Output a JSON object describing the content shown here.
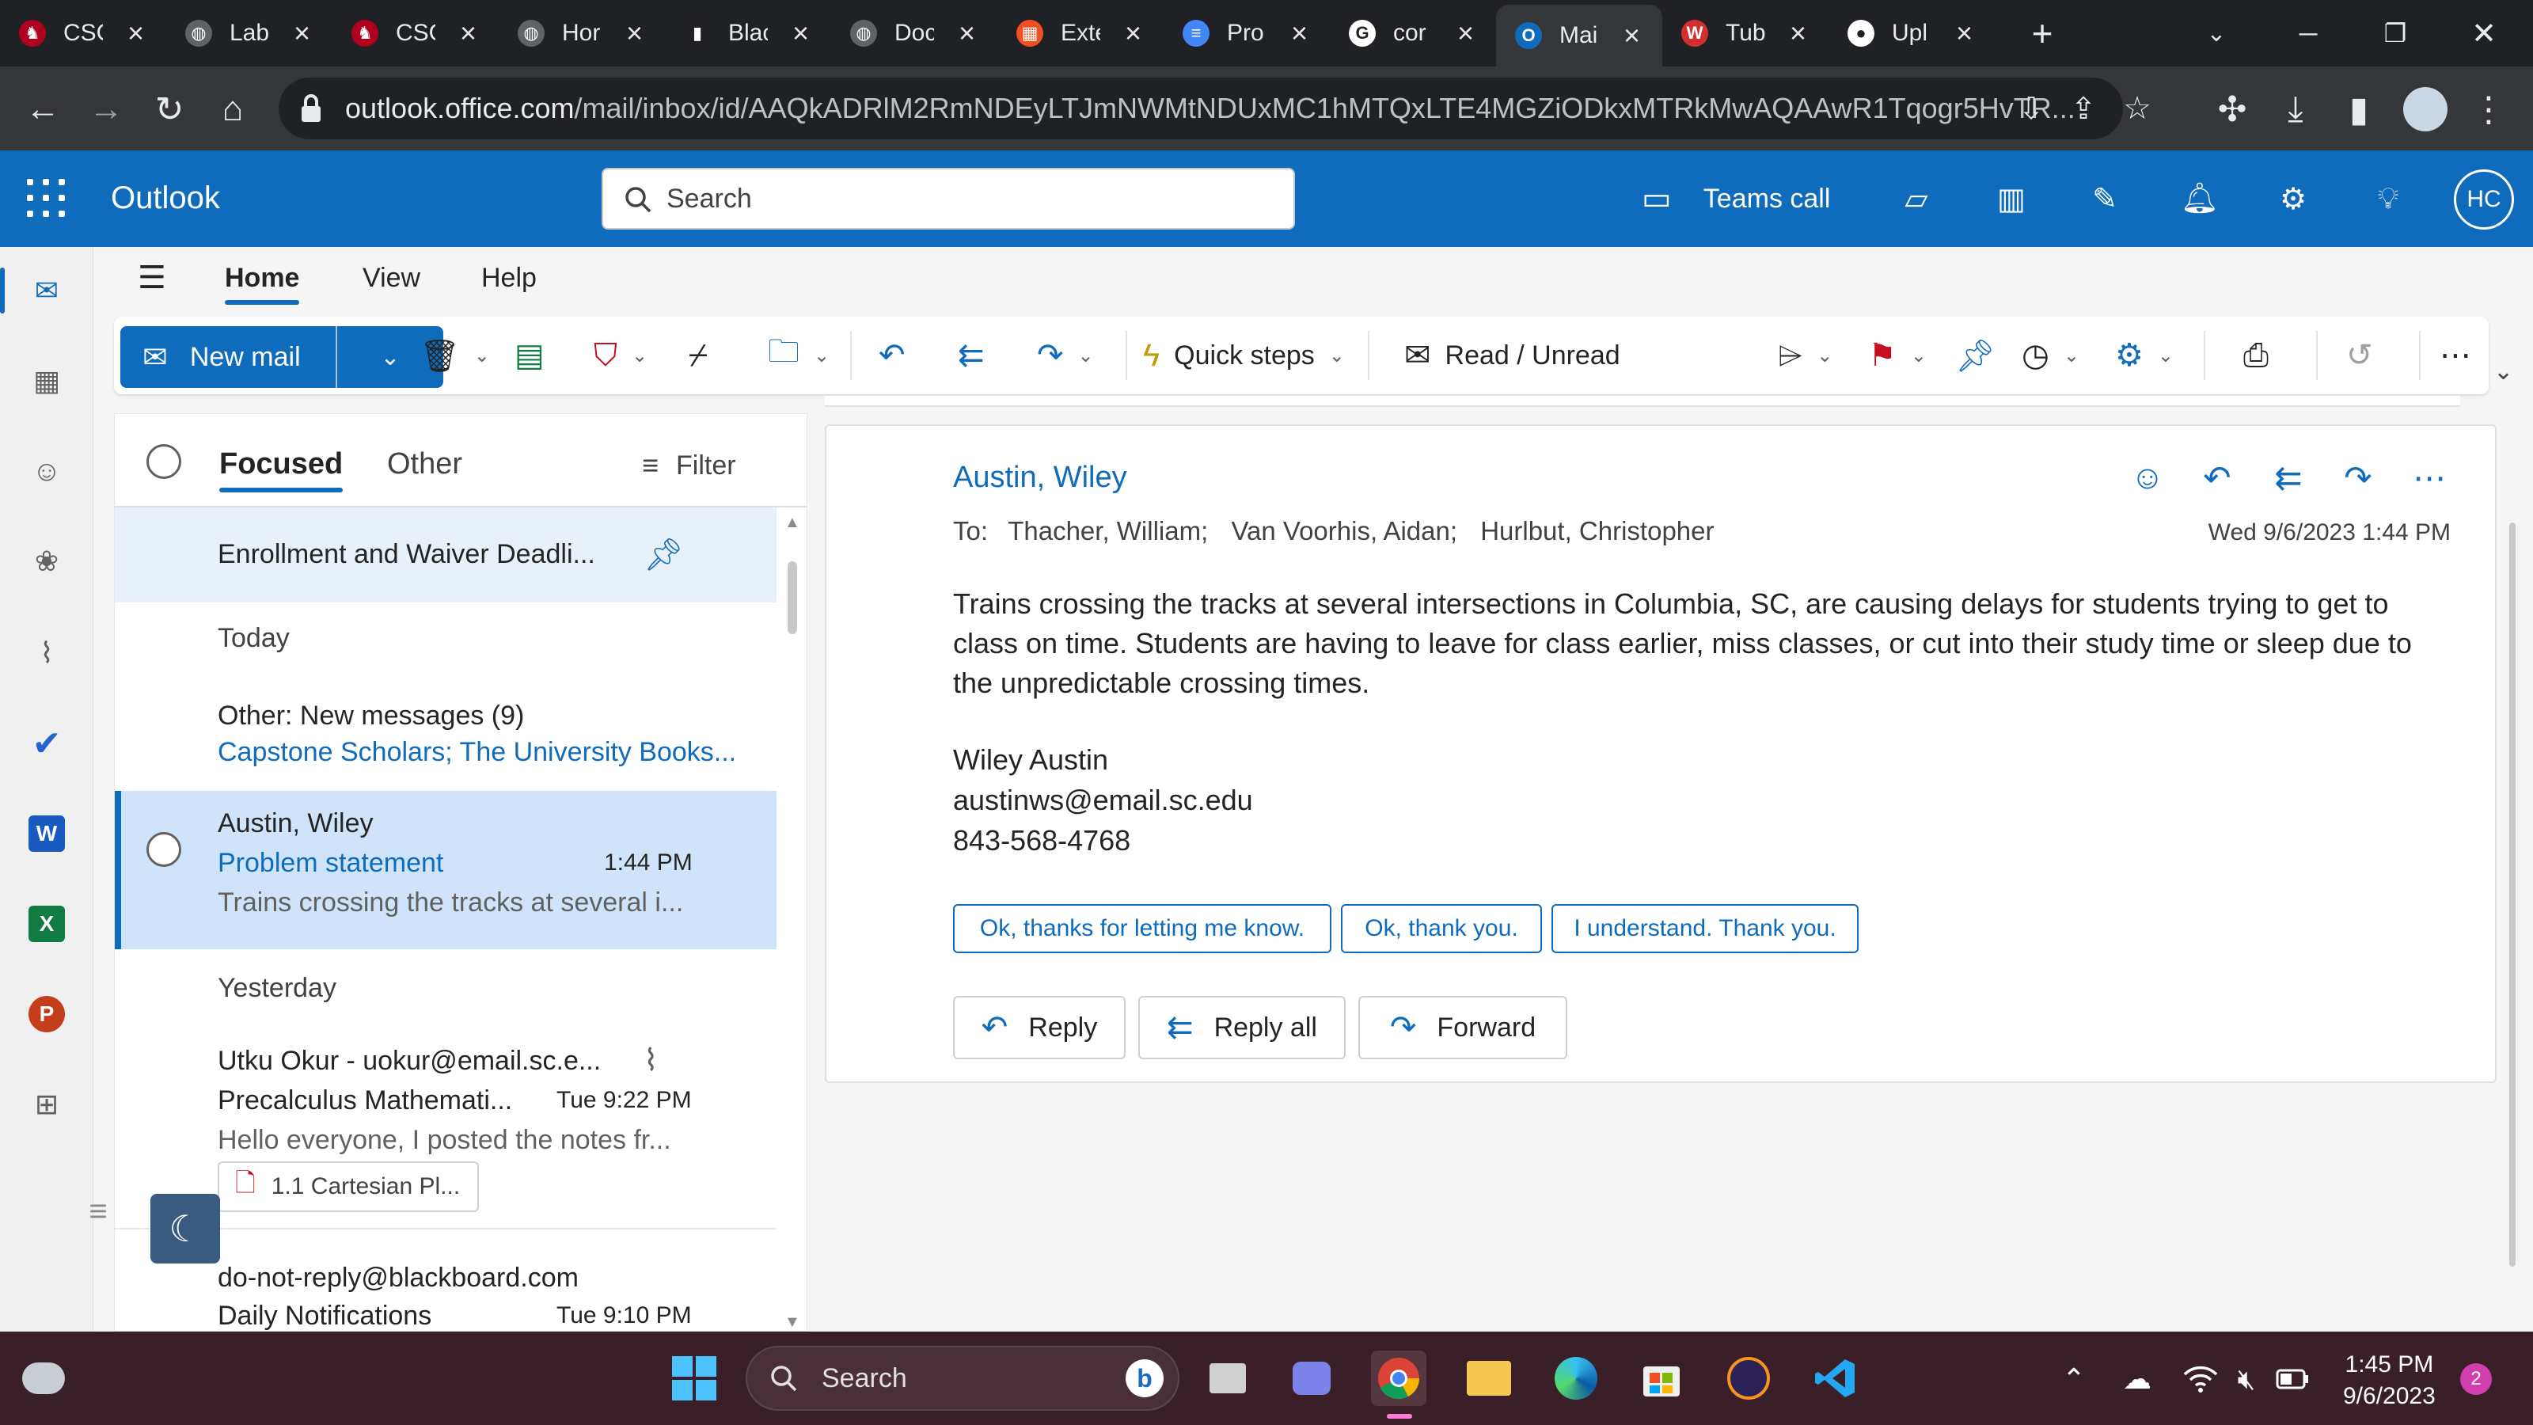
{
  "browser": {
    "tabs": [
      {
        "title": "CSC",
        "favicon": "spartan-icon",
        "color": "#b00020",
        "glyph": "♞"
      },
      {
        "title": "Lab",
        "favicon": "globe-icon",
        "color": "#5f6368",
        "glyph": "◍"
      },
      {
        "title": "CSC",
        "favicon": "spartan-icon",
        "color": "#b00020",
        "glyph": "♞"
      },
      {
        "title": "Hor",
        "favicon": "globe-icon",
        "color": "#5f6368",
        "glyph": "◍"
      },
      {
        "title": "Blac",
        "favicon": "bar-chart-icon",
        "color": "#202124",
        "glyph": "▮"
      },
      {
        "title": "Doc",
        "favicon": "globe-icon",
        "color": "#5f6368",
        "glyph": "◍"
      },
      {
        "title": "Exte",
        "favicon": "microsoft-icon",
        "color": "#f25022",
        "glyph": "▦"
      },
      {
        "title": "Pro",
        "favicon": "docs-icon",
        "color": "#4285f4",
        "glyph": "≡"
      },
      {
        "title": "cor",
        "favicon": "google-icon",
        "color": "#ffffff",
        "glyph": "G"
      },
      {
        "title": "Mai",
        "favicon": "outlook-icon",
        "color": "#0f6cbd",
        "glyph": "O"
      },
      {
        "title": "Tub",
        "favicon": "w-icon",
        "color": "#d32f2f",
        "glyph": "W"
      },
      {
        "title": "Upl",
        "favicon": "github-icon",
        "color": "#ffffff",
        "glyph": "●"
      }
    ],
    "url_host": "outlook.office.com",
    "url_path": "/mail/inbox/id/AAQkADRlM2RmNDEyLTJmNWMtNDUxMC1hMTQxLTE4MGZiODkxMTRkMwAQAAwR1Tqogr5HvTR..."
  },
  "outlook": {
    "brand": "Outlook",
    "search_placeholder": "Search",
    "teams_call": "Teams call",
    "avatar_initials": "HC",
    "ribbon_tabs": [
      "Home",
      "View",
      "Help"
    ],
    "toolbar": {
      "new_mail": "New mail",
      "quick_steps": "Quick steps",
      "read_unread": "Read / Unread"
    }
  },
  "message_list": {
    "tab_focused": "Focused",
    "tab_other": "Other",
    "filter": "Filter",
    "pinned": {
      "subject": "Enrollment and Waiver Deadli..."
    },
    "section_today": "Today",
    "other_group": {
      "title": "Other: New messages (9)",
      "senders": "Capstone Scholars; The University Books..."
    },
    "selected": {
      "sender": "Austin, Wiley",
      "subject": "Problem statement",
      "time": "1:44 PM",
      "preview": "Trains crossing the tracks at several i..."
    },
    "section_yesterday": "Yesterday",
    "item2": {
      "sender": "Utku Okur - uokur@email.sc.e...",
      "subject": "Precalculus Mathemati...",
      "time": "Tue 9:22 PM",
      "preview": "Hello everyone, I posted the notes fr...",
      "attachment": "1.1 Cartesian Pl..."
    },
    "item3": {
      "sender": "do-not-reply@blackboard.com",
      "subject": "Daily Notifications",
      "time": "Tue 9:10 PM"
    }
  },
  "reading_pane": {
    "sender": "Austin, Wiley",
    "to_label": "To:",
    "recipients": [
      "Thacher, William;",
      "Van Voorhis, Aidan;",
      "Hurlbut, Christopher"
    ],
    "date": "Wed 9/6/2023 1:44 PM",
    "body": "Trains crossing the tracks at several intersections in Columbia, SC, are causing delays for students trying to get to class on time. Students are having to leave for class earlier, miss classes, or cut into their study time or sleep due to the unpredictable crossing times.",
    "signature": [
      "Wiley Austin",
      "austinws@email.sc.edu",
      "843-568-4768"
    ],
    "suggestions": [
      "Ok, thanks for letting me know.",
      "Ok, thank you.",
      "I understand. Thank you."
    ],
    "reply": "Reply",
    "reply_all": "Reply all",
    "forward": "Forward"
  },
  "taskbar": {
    "search": "Search",
    "time": "1:45 PM",
    "date": "9/6/2023",
    "notifications": "2"
  }
}
